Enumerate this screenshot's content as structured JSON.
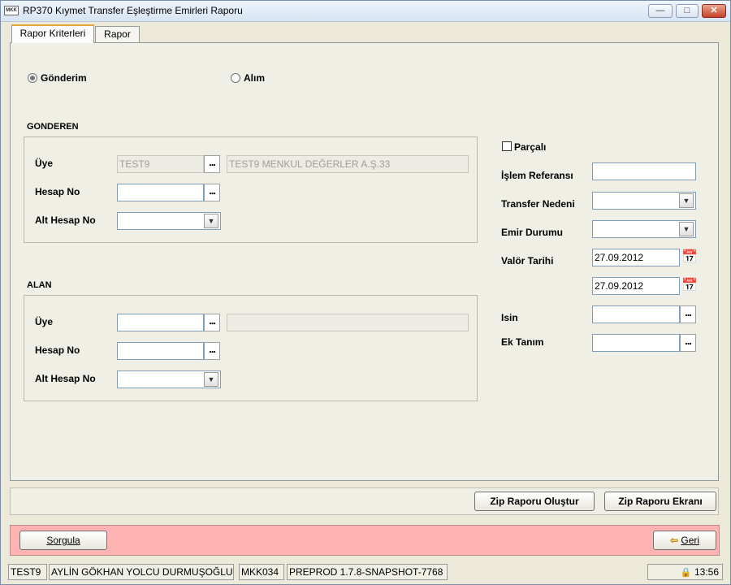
{
  "window": {
    "title": "RP370 Kıymet Transfer Eşleştirme Emirleri Raporu",
    "logo_text": "MKK",
    "minimize_glyph": "▭",
    "maximize_glyph": "□",
    "close_glyph": "✕"
  },
  "tabs": [
    {
      "label": "Rapor Kriterleri",
      "active": true
    },
    {
      "label": "Rapor",
      "active": false
    }
  ],
  "direction": {
    "options": [
      {
        "label": "Gönderim",
        "selected": true
      },
      {
        "label": "Alım",
        "selected": false
      }
    ]
  },
  "gonderen": {
    "title": "GONDEREN",
    "uye_label": "Üye",
    "uye_value": "TEST9",
    "uye_name": "TEST9 MENKUL DEĞERLER A.Ş.33",
    "hesap_label": "Hesap No",
    "hesap_value": "",
    "alt_hesap_label": "Alt Hesap No",
    "alt_hesap_value": ""
  },
  "alan": {
    "title": "ALAN",
    "uye_label": "Üye",
    "uye_value": "",
    "uye_name": "",
    "hesap_label": "Hesap No",
    "hesap_value": "",
    "alt_hesap_label": "Alt Hesap No",
    "alt_hesap_value": ""
  },
  "right": {
    "parcali_label": "Parçalı",
    "parcali_checked": false,
    "islem_ref_label": "İşlem Referansı",
    "islem_ref_value": "",
    "transfer_nedeni_label": "Transfer Nedeni",
    "transfer_nedeni_value": "",
    "emir_durumu_label": "Emir Durumu",
    "emir_durumu_value": "",
    "valor_label": "Valör Tarihi",
    "valor_start": "27.09.2012",
    "valor_end": "27.09.2012",
    "isin_label": "Isin",
    "isin_value": "",
    "ek_tanim_label": "Ek Tanım",
    "ek_tanim_value": ""
  },
  "icons": {
    "dots": "...",
    "combo_arrow": "▼",
    "calendar": "📅",
    "back_arrow": "⇦",
    "lock": "🔒"
  },
  "actions": {
    "zip_create": "Zip Raporu Oluştur",
    "zip_screen": "Zip Raporu Ekranı",
    "sorgula": "Sorgula",
    "geri": "Geri"
  },
  "status": {
    "user_code": "TEST9",
    "user_name": "AYLİN GÖKHAN YOLCU DURMUŞOĞLU",
    "institution": "MKK034",
    "version": "PREPROD 1.7.8-SNAPSHOT-7768",
    "time": "13:56"
  },
  "colors": {
    "action_strip": "#ffb3b3",
    "tab_accent": "#e5a83a",
    "calendar_icon": "#2a4da0"
  }
}
